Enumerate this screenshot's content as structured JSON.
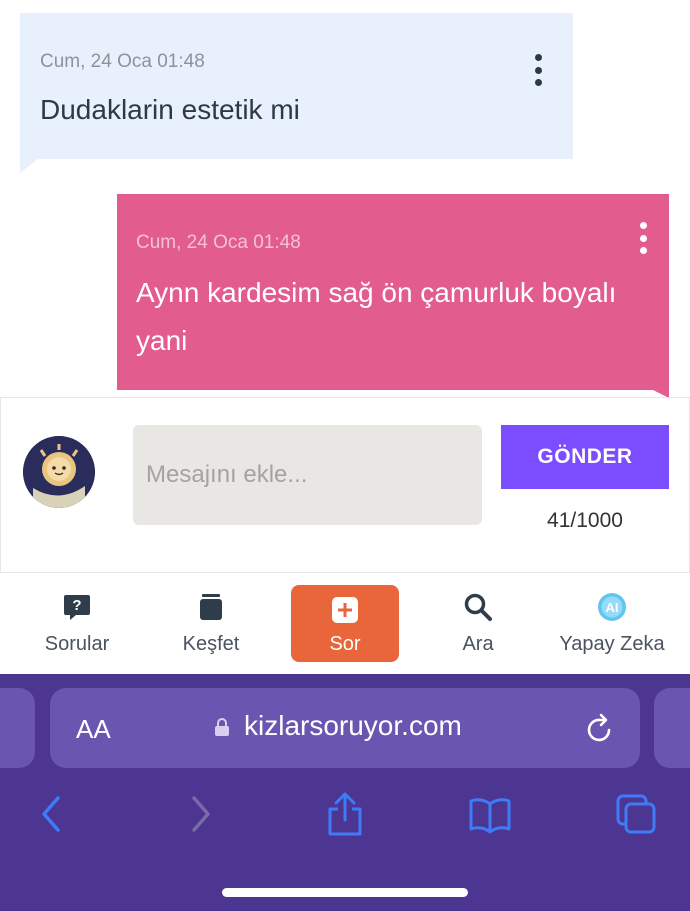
{
  "messages": [
    {
      "time": "Cum, 24 Oca 01:48",
      "text": "Dudaklarin estetik mi",
      "direction": "incoming"
    },
    {
      "time": "Cum, 24 Oca 01:48",
      "text": "Aynn kardesim sağ ön çamurluk boyalı yani",
      "direction": "outgoing"
    }
  ],
  "composer": {
    "placeholder": "Mesajını ekle...",
    "send_label": "GÖNDER",
    "char_count": "41/1000"
  },
  "nav": {
    "items": [
      {
        "label": "Sorular",
        "icon": "question-icon"
      },
      {
        "label": "Keşfet",
        "icon": "stack-icon"
      },
      {
        "label": "Sor",
        "icon": "plus-icon"
      },
      {
        "label": "Ara",
        "icon": "search-icon"
      },
      {
        "label": "Yapay Zeka",
        "icon": "ai-icon"
      }
    ]
  },
  "browser": {
    "text_size_label": "AA",
    "url": "kizlarsoruyor.com"
  },
  "colors": {
    "incoming_bubble": "#e8f0fb",
    "outgoing_bubble": "#e25d8d",
    "send_button": "#7c4dff",
    "ask_button": "#e8663a",
    "browser_bar": "#4d3592"
  }
}
